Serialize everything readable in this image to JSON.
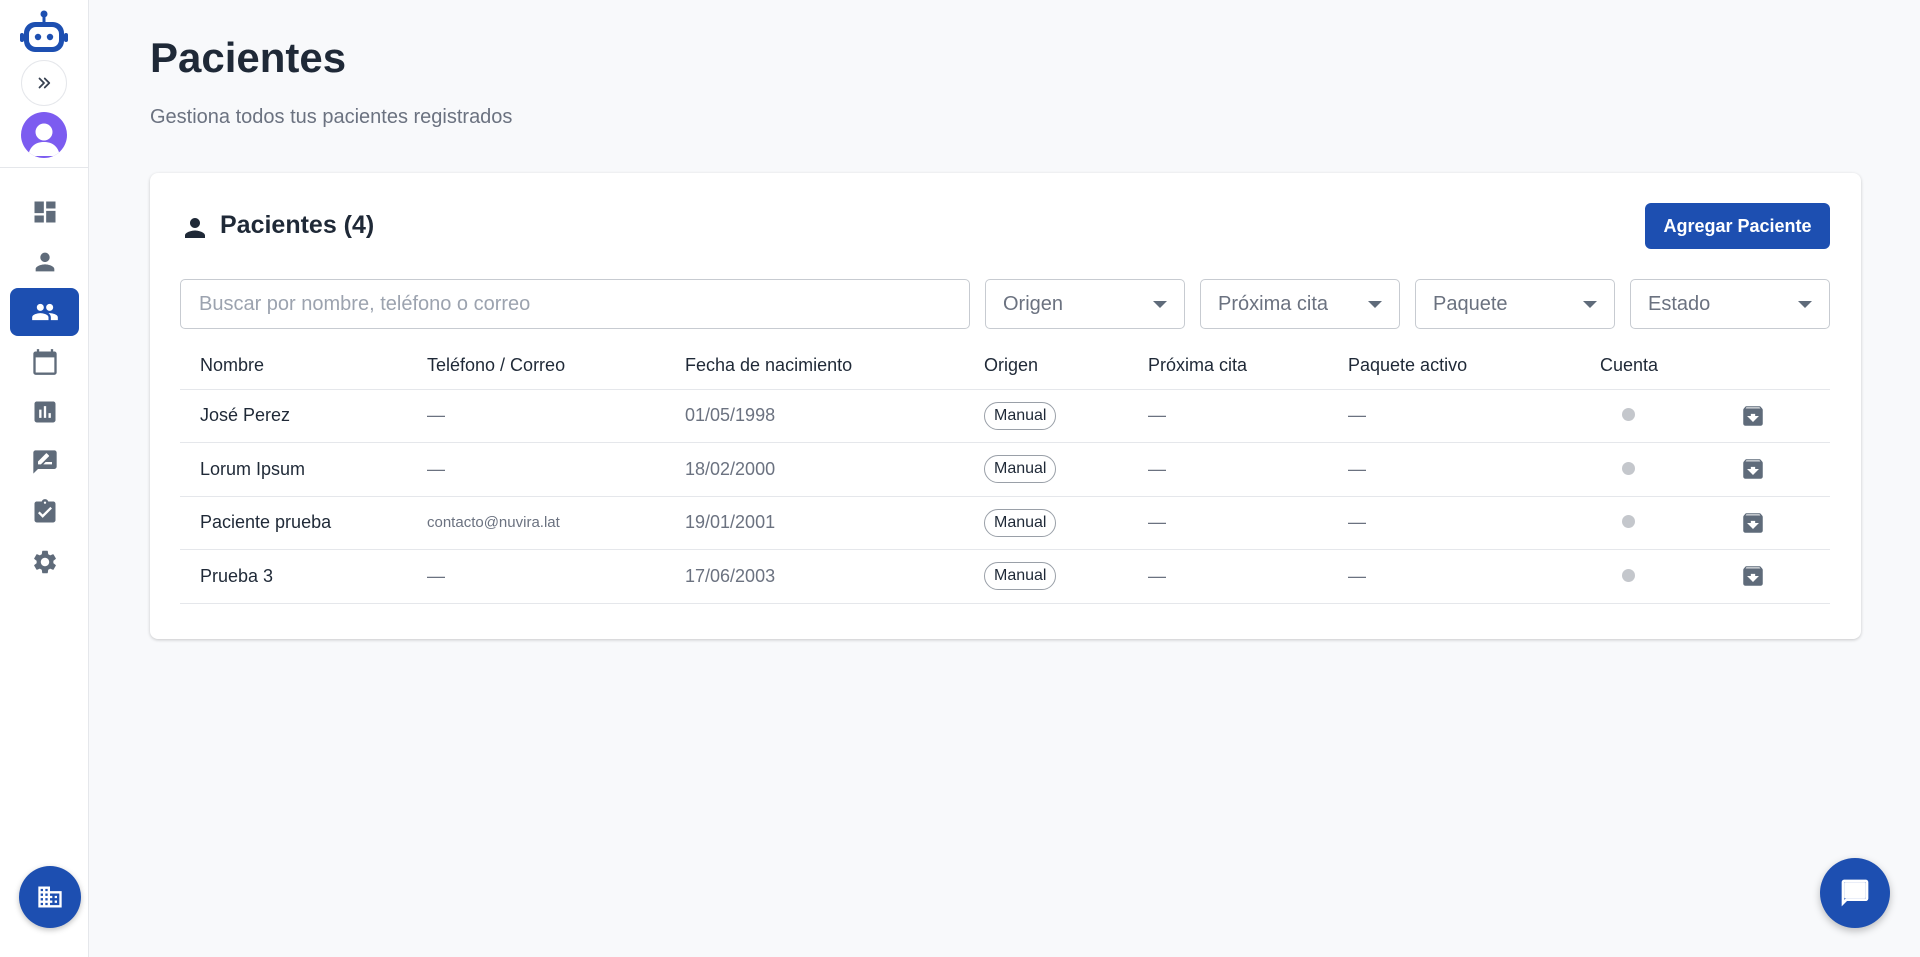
{
  "sidebar": {
    "nav_items": [
      "dashboard",
      "profile",
      "patients",
      "calendar",
      "reports",
      "notes",
      "tasks",
      "settings"
    ],
    "active": "patients"
  },
  "header": {
    "title": "Pacientes",
    "subtitle": "Gestiona todos tus pacientes registrados"
  },
  "card": {
    "title": "Pacientes (4)",
    "add_button": "Agregar Paciente"
  },
  "filters": {
    "search_placeholder": "Buscar por nombre, teléfono o correo",
    "origen": "Origen",
    "proxima_cita": "Próxima cita",
    "paquete": "Paquete",
    "estado": "Estado"
  },
  "table": {
    "columns": [
      "Nombre",
      "Teléfono / Correo",
      "Fecha de nacimiento",
      "Origen",
      "Próxima cita",
      "Paquete activo",
      "Cuenta"
    ],
    "rows": [
      {
        "name": "José Perez",
        "contact": "—",
        "birth": "01/05/1998",
        "origin": "Manual",
        "next": "—",
        "package": "—"
      },
      {
        "name": "Lorum Ipsum",
        "contact": "—",
        "birth": "18/02/2000",
        "origin": "Manual",
        "next": "—",
        "package": "—"
      },
      {
        "name": "Paciente prueba",
        "contact": "contacto@nuvira.lat",
        "birth": "19/01/2001",
        "origin": "Manual",
        "next": "—",
        "package": "—"
      },
      {
        "name": "Prueba 3",
        "contact": "—",
        "birth": "17/06/2003",
        "origin": "Manual",
        "next": "—",
        "package": "—"
      }
    ]
  },
  "colors": {
    "primary": "#1d4fb1",
    "avatar": "#7c5cf0",
    "status_dot": "#c4c7cc"
  }
}
